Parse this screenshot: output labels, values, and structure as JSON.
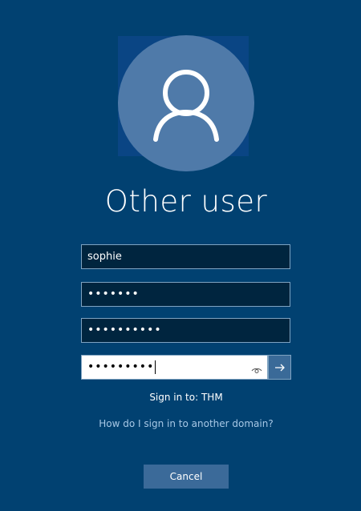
{
  "user": {
    "title": "Other user",
    "avatar_icon": "person-icon"
  },
  "form": {
    "username_value": "sophie",
    "password1_masked": "•••••••",
    "password2_masked": "••••••••••",
    "password3_masked": "•••••••••",
    "reveal_icon": "eye-icon",
    "submit_icon": "arrow-right-icon"
  },
  "footer": {
    "sign_in_to": "Sign in to: THM",
    "domain_link": "How do I sign in to another domain?",
    "cancel_label": "Cancel"
  },
  "colors": {
    "background": "#014171",
    "field_background": "#00253f",
    "field_border": "#7fa3c1",
    "avatar_circle": "#4f7aa9",
    "button": "#3b6a99",
    "link": "#a8c8e6"
  }
}
